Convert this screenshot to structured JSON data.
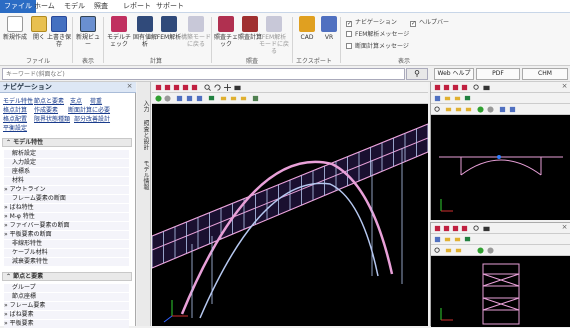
{
  "menu": {
    "tabs": [
      "ファイル",
      "ホーム",
      "モデル",
      "照査",
      "レポート",
      "サポート"
    ]
  },
  "ribbon": {
    "buttons": [
      {
        "label": "新規作成"
      },
      {
        "label": "開く"
      },
      {
        "label": "上書き保存"
      },
      {
        "label": "新規ビュー"
      },
      {
        "label": "モデルチェック"
      },
      {
        "label": "固有値解析"
      },
      {
        "label": "FEM解析"
      },
      {
        "label": "構築モードに戻る"
      },
      {
        "label": "照査チェック"
      },
      {
        "label": "照査計算"
      },
      {
        "label": "FEM解析モードに戻る"
      },
      {
        "label": "CAD"
      },
      {
        "label": "VR"
      }
    ],
    "groups": [
      "ファイル",
      "表示",
      "計算",
      "照査",
      "エクスポート",
      "表示"
    ],
    "checks": [
      {
        "label": "ナビゲーション",
        "checked": true
      },
      {
        "label": "ヘルプバー",
        "checked": true
      },
      {
        "label": "FEM解析メッセージ",
        "checked": false
      },
      {
        "label": "断面計算メッセージ",
        "checked": false
      }
    ]
  },
  "search": {
    "placeholder": "キーワード(斜面など)",
    "buttons": [
      "Web ヘルプ",
      "PDF",
      "CHM"
    ]
  },
  "nav": {
    "title": "ナビゲーション",
    "links": [
      "モデル特性",
      "節点と要素",
      "支点",
      "荷重",
      "格点計算",
      "作成要素",
      "断面計算に必要",
      "格点配置",
      "限界状態種類",
      "部分改善設計",
      "平衡設定"
    ],
    "sections": [
      {
        "title": "モデル特性",
        "items": [
          "解析設定",
          "入力設定",
          "座標系",
          "材料",
          "アウトライン",
          "フレーム要素の断面",
          "ばね特性",
          "M-φ 特性",
          "ファイバー要素の断面",
          "平板要素の断面",
          "非線形特性",
          "ケーブル材料",
          "減衰要素特性"
        ]
      },
      {
        "title": "節点と要素",
        "items": [
          "グループ",
          "節点座標",
          "フレーム要素",
          "ばね要素",
          "平板要素"
        ]
      }
    ]
  },
  "side_tabs": [
    "入力",
    "照査と設計",
    "モデル情報"
  ],
  "colors": {
    "accent": "#2b6cc4",
    "structure": "#e8a0d8",
    "structure_light": "#b6c8f0",
    "background_3d": "#000000"
  }
}
